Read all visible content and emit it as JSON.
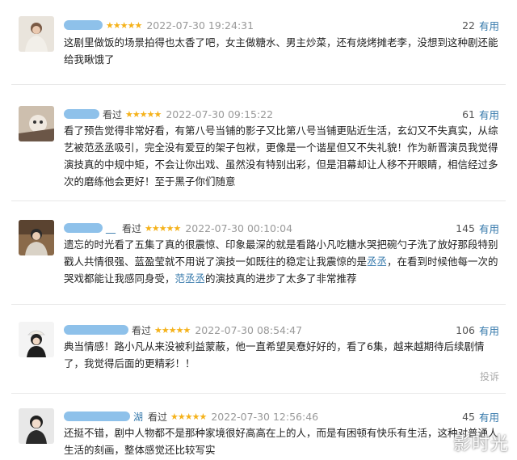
{
  "reviews": [
    {
      "watched": "",
      "stars": "★★★★★",
      "date": "2022-07-30 19:24:31",
      "useful_count": "22",
      "useful_label": "有用",
      "text": "这剧里做饭的场景拍得也太香了吧，女主做糖水、男主炒菜，还有烧烤摊老李，没想到这种剧还能给我瞅饿了"
    },
    {
      "watched": "看过",
      "stars": "★★★★★",
      "date": "2022-07-30 09:15:22",
      "useful_count": "61",
      "useful_label": "有用",
      "text": "看了预告觉得非常好看，有第八号当铺的影子又比第八号当铺更贴近生活，玄幻又不失真实，从综艺被范丞丞吸引，完全没有爱豆的架子包袱，更像是一个谐星但又不失礼貌！作为新晋演员我觉得演技真的中规中矩，不会让你出戏、虽然没有特别出彩，但是泪幕却让人移不开眼睛，相信经过多次的磨练他会更好！至于黑子你们随意"
    },
    {
      "name_suffix": "__",
      "watched": "看过",
      "stars": "★★★★★",
      "date": "2022-07-30 00:10:04",
      "useful_count": "145",
      "useful_label": "有用",
      "text_a": "遗忘的时光看了五集了真的很震惊、印象最深的就是看路小凡吃糖水哭把碗勺子洗了放好那段特别戳人共情很强、蓝盈莹就不用说了演技一如既往的稳定让我震惊的是",
      "text_hl1": "丞丞",
      "text_b": "，在看到时候他每一次的哭戏都能让我感同身受，",
      "text_hl2": "范丞丞",
      "text_c": "的演技真的进步了太多了非常推荐"
    },
    {
      "watched": "看过",
      "stars": "★★★★★",
      "date": "2022-07-30 08:54:47",
      "useful_count": "106",
      "useful_label": "有用",
      "text": "典当情感！路小凡从来没被利益蒙蔽，他一直希望吴憃好好的，看了6集，越来越期待后续剧情了，我觉得后面的更精彩！！",
      "report": "投诉"
    },
    {
      "name_suffix": "湖",
      "watched": "看过",
      "stars": "★★★★★",
      "date": "2022-07-30 12:56:46",
      "useful_count": "45",
      "useful_label": "有用",
      "text": "还挺不错，剧中人物都不是那种家境很好高高在上的人，而是有困顿有快乐有生活，这种对普通人生活的刻画，整体感觉还比较写实"
    }
  ],
  "watermark": "影时光"
}
